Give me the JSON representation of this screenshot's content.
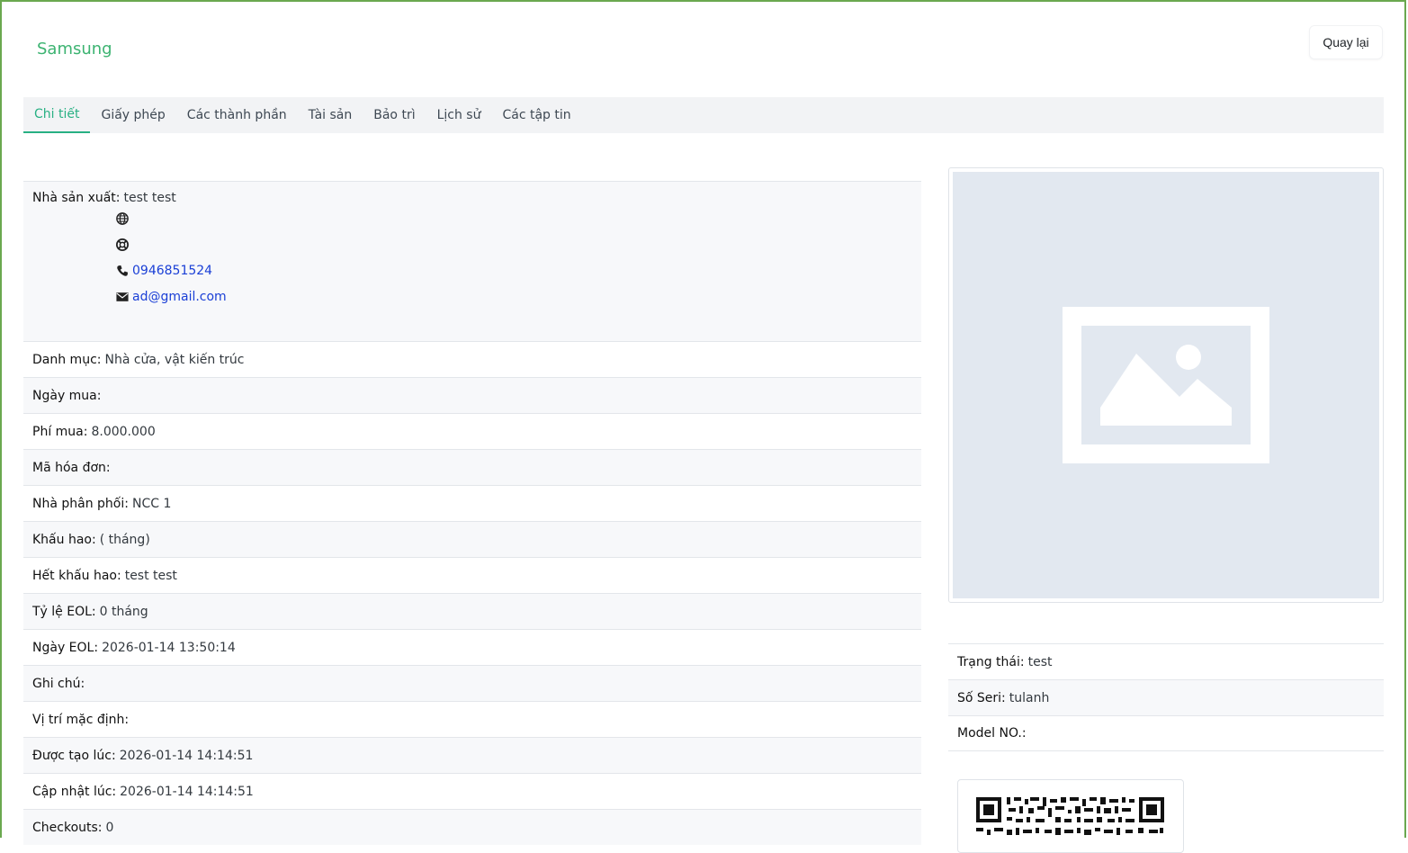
{
  "header": {
    "brand": "Samsung",
    "back_label": "Quay lại"
  },
  "tabs": [
    {
      "label": "Chi tiết",
      "active": true
    },
    {
      "label": "Giấy phép"
    },
    {
      "label": "Các thành phần"
    },
    {
      "label": "Tài sản"
    },
    {
      "label": "Bảo trì"
    },
    {
      "label": "Lịch sử"
    },
    {
      "label": "Các tập tin"
    }
  ],
  "manufacturer": {
    "label": "Nhà sản xuất:",
    "value": "test test",
    "phone": "0946851524",
    "email": "ad@gmail.com"
  },
  "details": [
    {
      "label": "Danh mục:",
      "value": "Nhà cửa, vật kiến trúc"
    },
    {
      "label": "Ngày mua:",
      "value": ""
    },
    {
      "label": "Phí mua:",
      "value": "8.000.000"
    },
    {
      "label": "Mã hóa đơn:",
      "value": ""
    },
    {
      "label": "Nhà phân phối:",
      "value": "NCC 1"
    },
    {
      "label": "Khấu hao:",
      "value": "( tháng)"
    },
    {
      "label": "Hết khấu hao:",
      "value": "test test"
    },
    {
      "label": "Tỷ lệ EOL:",
      "value": "0 tháng"
    },
    {
      "label": "Ngày EOL:",
      "value": "2026-01-14 13:50:14"
    },
    {
      "label": "Ghi chú:",
      "value": ""
    },
    {
      "label": "Vị trí mặc định:",
      "value": ""
    },
    {
      "label": "Được tạo lúc:",
      "value": "2026-01-14 14:14:51"
    },
    {
      "label": "Cập nhật lúc:",
      "value": "2026-01-14 14:14:51"
    },
    {
      "label": "Checkouts:",
      "value": "0"
    }
  ],
  "side_details": [
    {
      "label": "Trạng thái:",
      "value": "test"
    },
    {
      "label": "Số Seri:",
      "value": "tulanh"
    },
    {
      "label": "Model NO.:",
      "value": ""
    }
  ],
  "icons": {
    "website": "globe-icon",
    "support": "lifebuoy-icon",
    "phone": "phone-icon",
    "email": "envelope-icon",
    "image": "image-placeholder-icon",
    "qr": "qr-code"
  },
  "colors": {
    "accent": "#28b083",
    "brand": "#3cb371",
    "link": "#1a3fd6",
    "frame": "#6aa84f"
  }
}
